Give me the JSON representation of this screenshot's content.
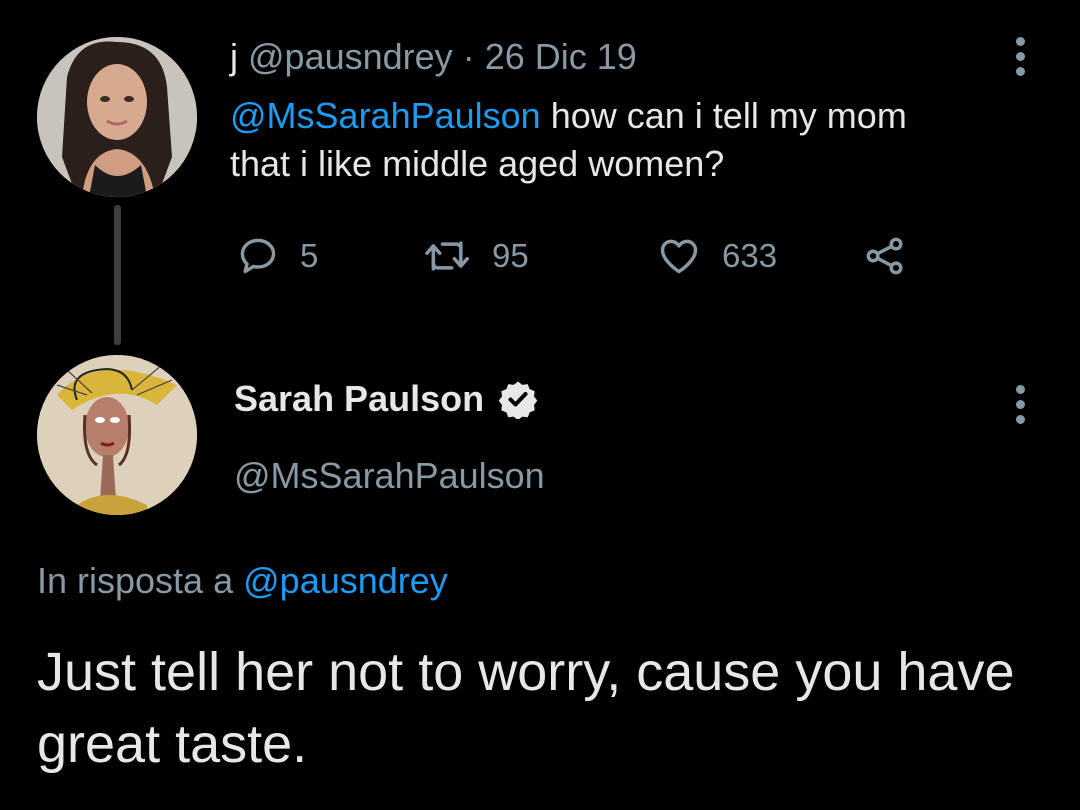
{
  "tweet1": {
    "display_name": "j",
    "handle": "@pausndrey",
    "separator": "·",
    "date": "26 Dic 19",
    "mention": "@MsSarahPaulson",
    "text": " how can i tell my mom that i like middle aged women?",
    "reply_count": "5",
    "retweet_count": "95",
    "like_count": "633",
    "avatar_icon": "profile-photo"
  },
  "tweet2": {
    "display_name": "Sarah Paulson",
    "verified_icon": "verified-badge-icon",
    "handle": "@MsSarahPaulson",
    "reply_prefix": "In risposta a",
    "reply_to": "@pausndrey",
    "text": "Just tell her not to worry, cause you have great taste.",
    "avatar_icon": "illustrated-portrait"
  },
  "colors": {
    "background": "#000000",
    "text": "#e7e7e7",
    "muted": "#8899a6",
    "accent": "#1d9bf0"
  }
}
